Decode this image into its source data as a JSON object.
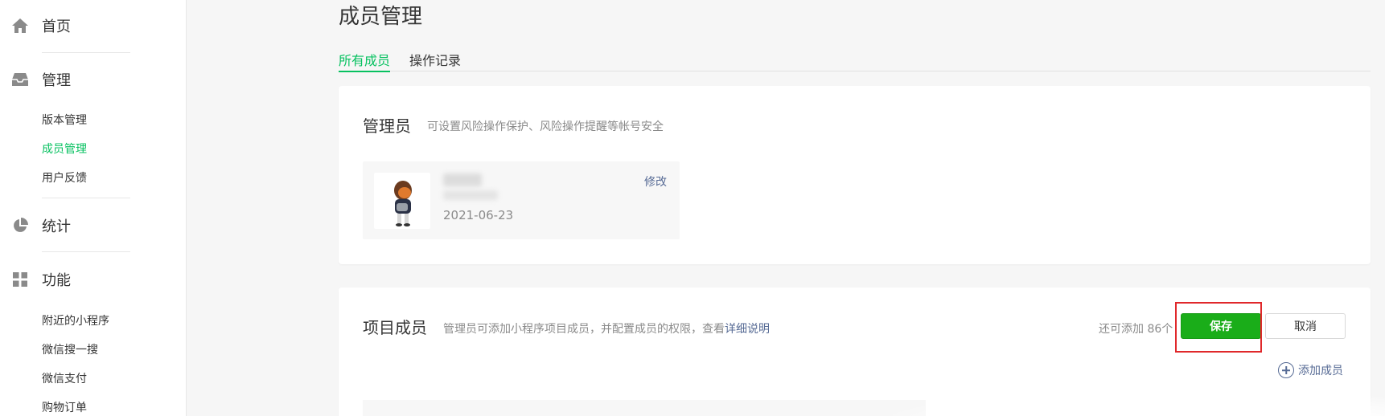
{
  "sidebar": {
    "home": {
      "label": "首页",
      "icon": "home-icon"
    },
    "manage": {
      "label": "管理",
      "icon": "inbox-icon",
      "items": [
        {
          "label": "版本管理",
          "active": false
        },
        {
          "label": "成员管理",
          "active": true
        },
        {
          "label": "用户反馈",
          "active": false
        }
      ]
    },
    "stats": {
      "label": "统计",
      "icon": "pie-chart-icon"
    },
    "features": {
      "label": "功能",
      "icon": "grid-icon",
      "items": [
        {
          "label": "附近的小程序"
        },
        {
          "label": "微信搜一搜"
        },
        {
          "label": "微信支付"
        },
        {
          "label": "购物订单"
        }
      ]
    }
  },
  "page": {
    "title": "成员管理",
    "tabs": [
      {
        "label": "所有成员",
        "active": true
      },
      {
        "label": "操作记录",
        "active": false
      }
    ]
  },
  "admin_card": {
    "title": "管理员",
    "desc": "可设置风险操作保护、风险操作提醒等帐号安全",
    "admin": {
      "date": "2021-06-23",
      "edit_label": "修改"
    }
  },
  "members_card": {
    "title": "项目成员",
    "desc_prefix": "管理员可添加小程序项目成员，并配置成员的权限，查看",
    "desc_link": "详细说明",
    "remaining": "还可添加 86个",
    "save_label": "保存",
    "cancel_label": "取消",
    "add_member_label": "添加成员"
  },
  "colors": {
    "accent": "#07c160",
    "primary_button": "#1aad19",
    "link": "#576b95",
    "highlight": "#e0282b"
  }
}
